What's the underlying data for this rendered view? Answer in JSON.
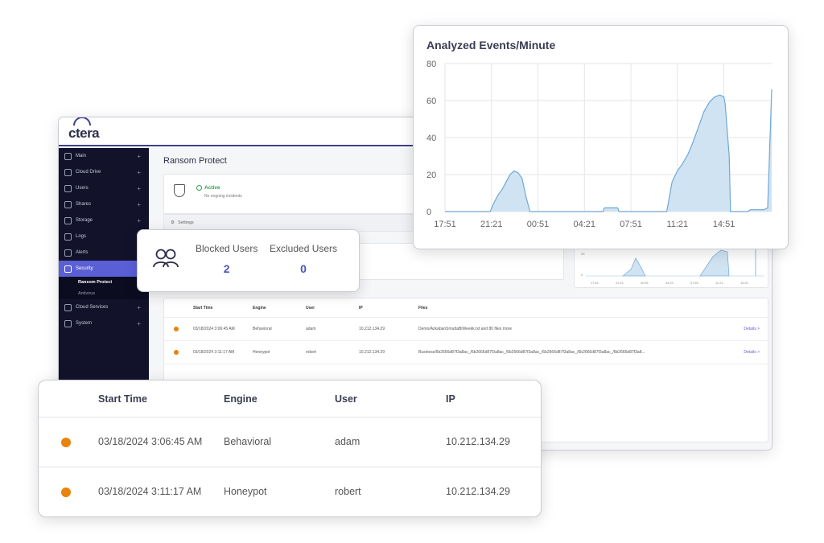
{
  "app": {
    "logo": "ctera",
    "page_title": "Ransom Protect",
    "status": {
      "label": "Active",
      "sub": "No ongoing incidents"
    },
    "settings_label": "Settings",
    "sidebar": [
      {
        "label": "Main",
        "plus": "+"
      },
      {
        "label": "Cloud Drive",
        "plus": "+"
      },
      {
        "label": "Users",
        "plus": "+"
      },
      {
        "label": "Shares",
        "plus": "+"
      },
      {
        "label": "Storage",
        "plus": "+"
      },
      {
        "label": "Logs",
        "plus": ""
      },
      {
        "label": "Alerts",
        "plus": ""
      },
      {
        "label": "Security",
        "plus": ""
      },
      {
        "label": "Cloud Services",
        "plus": "+"
      },
      {
        "label": "System",
        "plus": "+"
      }
    ],
    "security_sub": [
      "Ransom Protect",
      "Antivirus"
    ],
    "mini_chart_ticks": [
      "17:51",
      "21:21",
      "00:51",
      "04:21",
      "07:51",
      "11:21",
      "14:51"
    ],
    "mini_chart_y": [
      "20",
      "0"
    ],
    "table": {
      "headers": [
        "Start Time",
        "Engine",
        "User",
        "IP",
        "Files"
      ],
      "rows": [
        {
          "time": "03/18/2024 3:06:45 AM",
          "engine": "Behavioral",
          "user": "adam",
          "ip": "10.212.134.29",
          "files": "Demo/AzkabanSmuttaBiWeekk.txt and 80 files more",
          "details": "Details >"
        },
        {
          "time": "03/18/2024 3:11:17 AM",
          "engine": "Honeypot",
          "user": "robert",
          "ip": "10.212.134.29",
          "files": "Business/6b2666d87f3a8ac_/6b2666d87f3a8ac_/6b2666d87f3a8ac_/6b2666d87f3a8ac_/6b2666d87f3a8ac_/6b2666d87f3a8...",
          "details": "Details >"
        }
      ]
    }
  },
  "users_card": {
    "blocked_label": "Blocked Users",
    "blocked_value": "2",
    "excluded_label": "Excluded Users",
    "excluded_value": "0"
  },
  "front_table": {
    "headers": [
      "Start Time",
      "Engine",
      "User",
      "IP"
    ],
    "rows": [
      {
        "time": "03/18/2024 3:06:45 AM",
        "engine": "Behavioral",
        "user": "adam",
        "ip": "10.212.134.29"
      },
      {
        "time": "03/18/2024 3:11:17 AM",
        "engine": "Honeypot",
        "user": "robert",
        "ip": "10.212.134.29"
      }
    ]
  },
  "colors": {
    "accent": "#5a5fd6",
    "status_orange": "#e8830c",
    "chart_fill": "#cfe3f3",
    "chart_line": "#6fa8d6"
  },
  "chart_data": {
    "type": "area",
    "title": "Analyzed Events/Minute",
    "xlabel": "",
    "ylabel": "",
    "ylim": [
      0,
      80
    ],
    "yticks": [
      0,
      20,
      40,
      60,
      80
    ],
    "xticks": [
      "17:51",
      "21:21",
      "00:51",
      "04:21",
      "07:51",
      "11:21",
      "14:51"
    ],
    "grid": true,
    "x_hours": [
      0,
      1,
      2,
      3,
      3.4,
      3.7,
      4.0,
      4.3,
      4.6,
      4.9,
      5.2,
      5.5,
      5.8,
      6.1,
      6.4,
      6.7,
      7.0,
      7.5,
      8.0,
      9.0,
      10.0,
      11.9,
      12.0,
      13.0,
      13.1,
      14.0,
      15.0,
      16.0,
      16.7,
      17.1,
      17.5,
      17.9,
      18.3,
      18.7,
      19.1,
      19.5,
      19.9,
      20.3,
      20.7,
      21.0,
      21.1,
      21.4,
      21.5,
      22.0,
      22.8,
      23.0,
      24.0,
      24.3,
      24.6
    ],
    "values": [
      0,
      0,
      0,
      0,
      0,
      5,
      9,
      12,
      16,
      20,
      22,
      21,
      18,
      8,
      0,
      0,
      0,
      0,
      0,
      0,
      0,
      0,
      2,
      2,
      0,
      0,
      0,
      0,
      0,
      16,
      22,
      26,
      31,
      38,
      46,
      54,
      59,
      62,
      63,
      62,
      58,
      30,
      0,
      0,
      0,
      1,
      1,
      2,
      66
    ]
  }
}
